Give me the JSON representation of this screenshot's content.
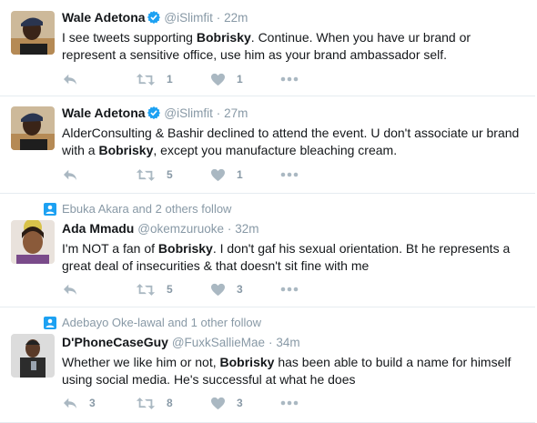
{
  "tweets": [
    {
      "name": "Wale Adetona",
      "handle": "@iSlimfit",
      "time": "22m",
      "text_parts": [
        "I see tweets supporting ",
        "Bobrisky",
        ". Continue. When you have ur brand or represent a sensitive office, use him as your brand ambassador self."
      ],
      "retweets": "1",
      "likes": "1",
      "context": ""
    },
    {
      "name": "Wale Adetona",
      "handle": "@iSlimfit",
      "time": "27m",
      "text_parts": [
        "AlderConsulting & Bashir declined to attend the event. U don't associate ur brand with a ",
        "Bobrisky",
        ", except you manufacture bleaching cream."
      ],
      "retweets": "5",
      "likes": "1",
      "context": ""
    },
    {
      "name": "Ada Mmadu",
      "handle": "@okemzuruoke",
      "time": "32m",
      "text_parts": [
        "I'm NOT a fan of ",
        "Bobrisky",
        ". I don't gaf his sexual orientation. Bt he represents a great deal of insecurities & that doesn't sit fine with me"
      ],
      "retweets": "5",
      "likes": "3",
      "context": "Ebuka Akara and 2 others follow"
    },
    {
      "name": "D'PhoneCaseGuy",
      "handle": "@FuxkSallieMae",
      "time": "34m",
      "text_parts": [
        "Whether we like him or not,  ",
        "Bobrisky",
        " has been able to build a name for himself using social media.  He's successful at what he does"
      ],
      "replies": "3",
      "retweets": "8",
      "likes": "3",
      "context": "Adebayo Oke-lawal and 1 other follow"
    }
  ],
  "separator_dot": "·",
  "colors": {
    "verified": "#1da1f2",
    "muted": "#8899a6",
    "text": "#14171a",
    "border": "#e6ecf0"
  }
}
